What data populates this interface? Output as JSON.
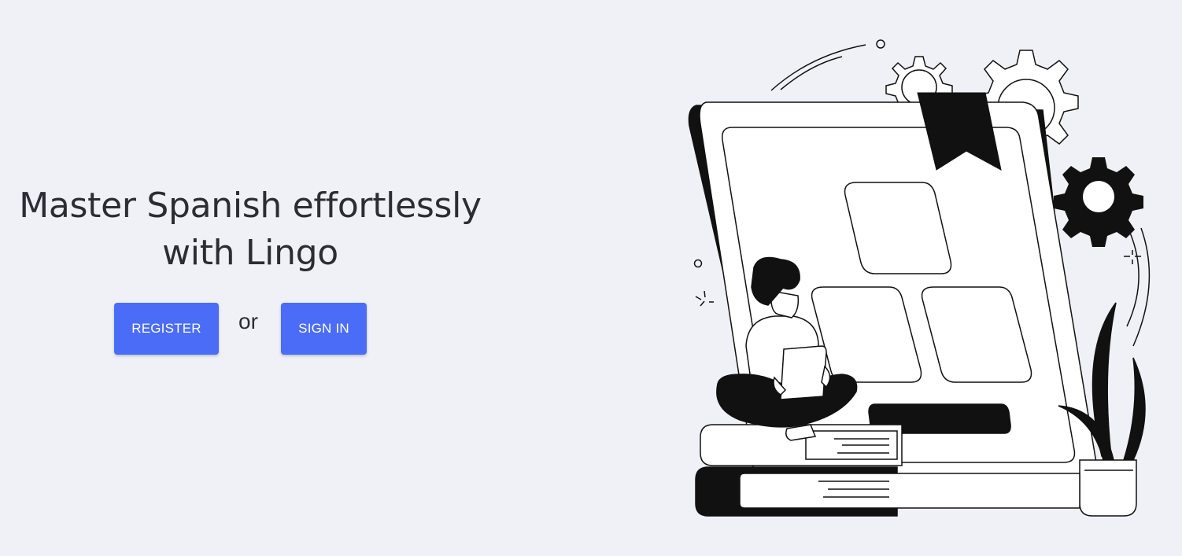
{
  "hero": {
    "headline_line1": "Master Spanish effortlessly",
    "headline_line2": "with Lingo"
  },
  "actions": {
    "register_label": "REGISTER",
    "separator": "or",
    "signin_label": "SIGN IN"
  },
  "colors": {
    "background": "#f0f1f6",
    "primary_button": "#4a6cf7",
    "text": "#2b2d35"
  },
  "illustration": {
    "name": "person-reading-on-books-with-tablet-and-gears"
  }
}
